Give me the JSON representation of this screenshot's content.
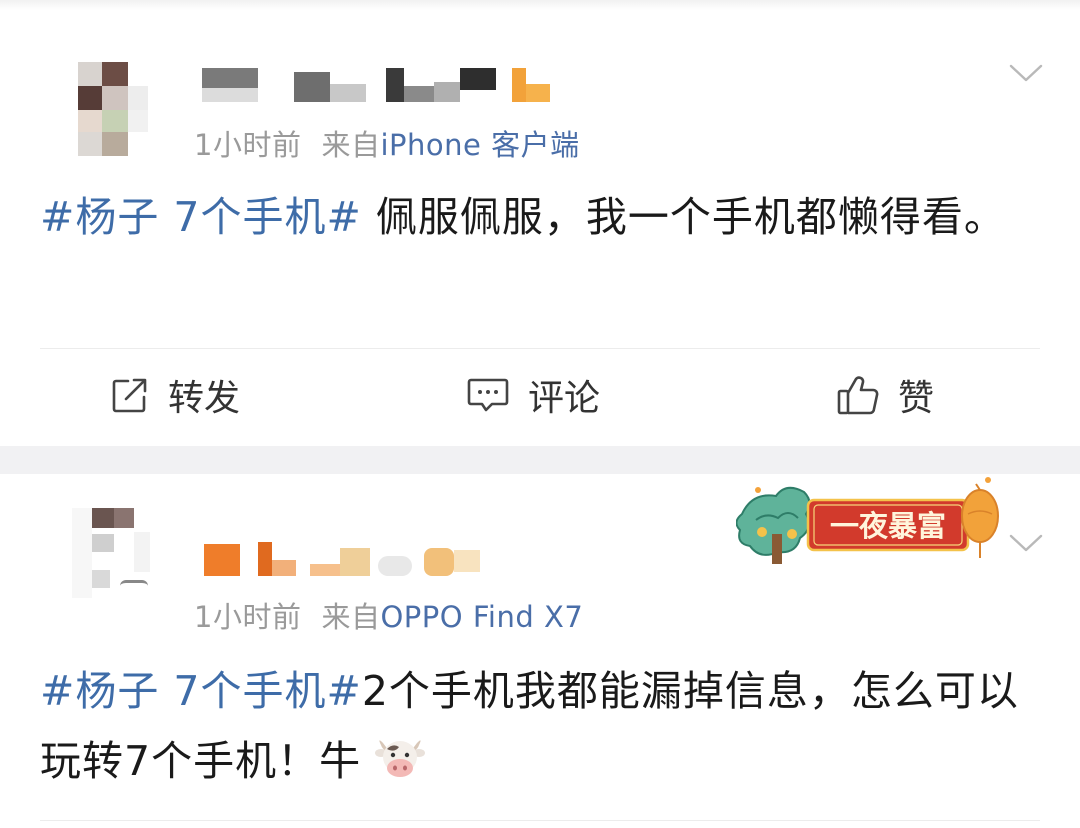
{
  "posts": [
    {
      "time": "1小时前",
      "source_prefix": "来自",
      "source": "iPhone 客户端",
      "topic": "#杨子 7个手机#",
      "body": " 佩服佩服，我一个手机都懒得看。",
      "actions": {
        "repost": "转发",
        "comment": "评论",
        "like": "赞"
      }
    },
    {
      "time": "1小时前",
      "source_prefix": "来自",
      "source": "OPPO Find X7",
      "topic": "#杨子 7个手机#",
      "body": "2个手机我都能漏掉信息，怎么可以玩转7个手机！牛",
      "emoji": "cow-face",
      "badge": {
        "text": "一夜暴富",
        "colors": {
          "banner": "#d23a2c",
          "frame": "#3aa08a",
          "lantern": "#f2a23a"
        }
      }
    }
  ],
  "colors": {
    "topic": "#3e6ca8",
    "meta": "#9a9a9a",
    "separator": "#f1f1f3"
  },
  "icons": [
    "edit-share-icon",
    "comment-bubble-icon",
    "thumbs-up-icon",
    "chevron-down-icon"
  ]
}
